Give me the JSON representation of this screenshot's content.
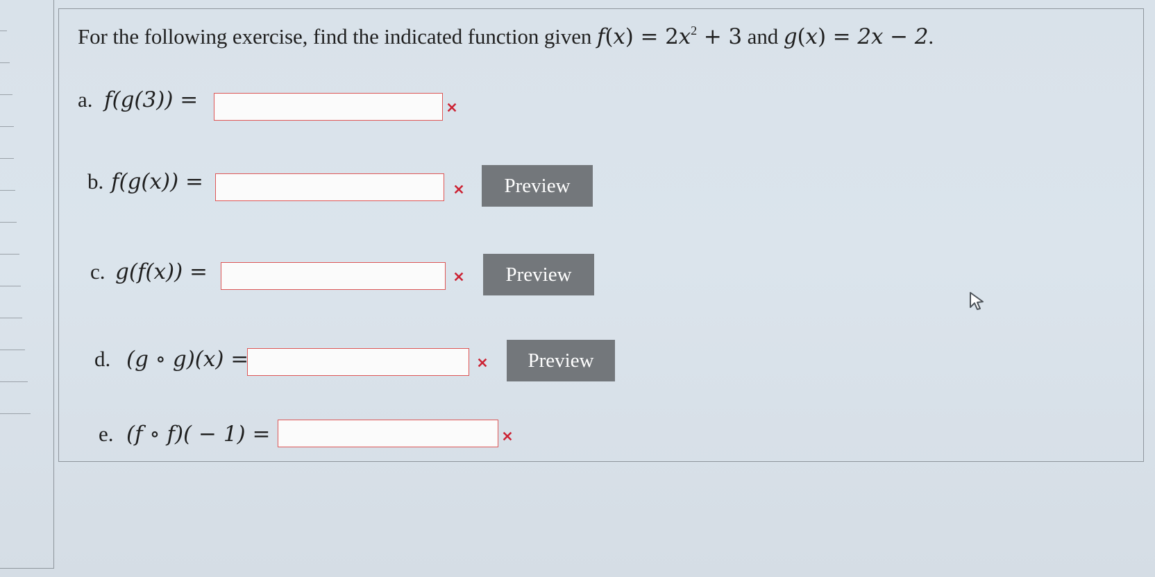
{
  "prompt": {
    "text_before": "For the following exercise, find the indicated function given ",
    "f_name": "f",
    "variable": "x",
    "f_expr_coeff": "2",
    "f_expr_var": "x",
    "f_expr_exp": "2",
    "f_expr_tail": " + 3",
    "joiner": " and ",
    "g_name": "g",
    "g_expr": "2x − 2",
    "ending": "."
  },
  "parts": [
    {
      "label": "a.",
      "expression": "f(g(3)) =",
      "input_value": "",
      "status_icon": "error-x-icon",
      "preview_label": ""
    },
    {
      "label": "b.",
      "expression": "f(g(x)) =",
      "input_value": "",
      "status_icon": "error-x-icon",
      "preview_label": "Preview"
    },
    {
      "label": "c.",
      "expression": "g(f(x)) =",
      "input_value": "",
      "status_icon": "error-x-icon",
      "preview_label": "Preview"
    },
    {
      "label": "d.",
      "expression": "(g ∘ g)(x) =",
      "input_value": "",
      "status_icon": "error-x-icon",
      "preview_label": "Preview"
    },
    {
      "label": "e.",
      "expression": "(f ∘ f)( − 1) =",
      "input_value": "",
      "status_icon": "error-x-icon",
      "preview_label": ""
    }
  ],
  "colors": {
    "background": "#dbe4ec",
    "error_red": "#cc2233",
    "button_gray": "#73777b"
  },
  "icons": {
    "error": "error-x-icon",
    "cursor": "mouse-pointer-icon"
  }
}
